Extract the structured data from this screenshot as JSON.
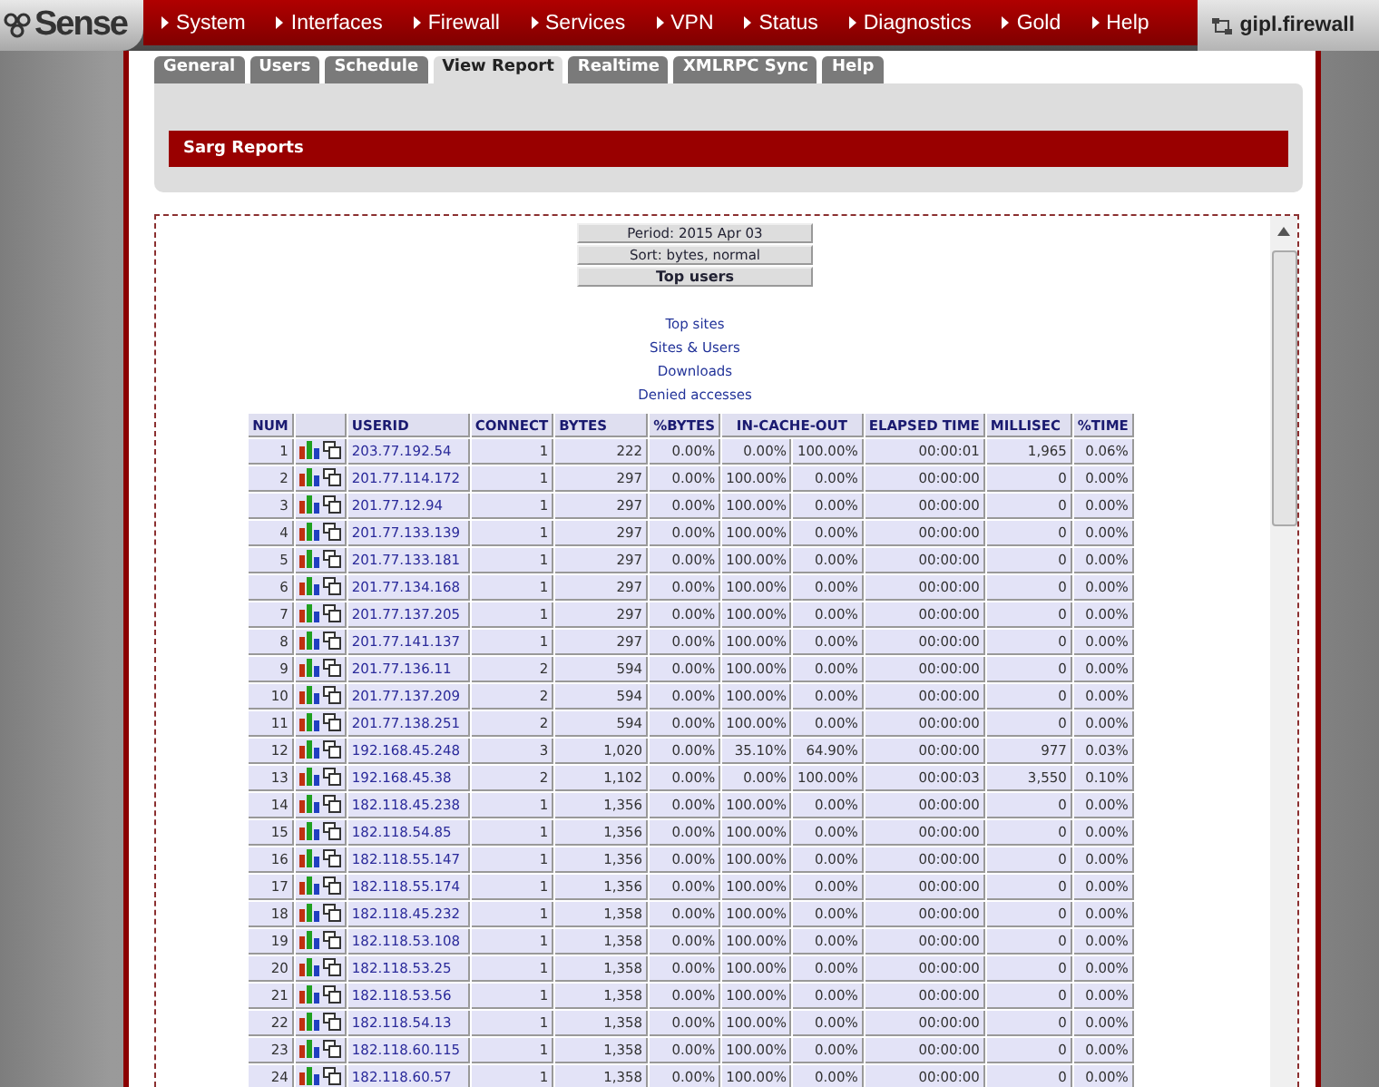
{
  "logo": {
    "text": "Sense"
  },
  "nav": [
    "System",
    "Interfaces",
    "Firewall",
    "Services",
    "VPN",
    "Status",
    "Diagnostics",
    "Gold",
    "Help"
  ],
  "host": "gipl.firewall",
  "tabs": [
    {
      "label": "General",
      "selected": false
    },
    {
      "label": "Users",
      "selected": false
    },
    {
      "label": "Schedule",
      "selected": false
    },
    {
      "label": "View Report",
      "selected": true
    },
    {
      "label": "Realtime",
      "selected": false
    },
    {
      "label": "XMLRPC Sync",
      "selected": false
    },
    {
      "label": "Help",
      "selected": false
    }
  ],
  "section_title": "Sarg Reports",
  "report": {
    "info": [
      "Period: 2015 Apr 03",
      "Sort: bytes, normal",
      "Top users"
    ],
    "links": [
      "Top sites",
      "Sites & Users",
      "Downloads",
      "Denied accesses"
    ],
    "columns": [
      {
        "label": "NUM",
        "kind": "single"
      },
      {
        "label": "USERID",
        "kind": "single"
      },
      {
        "label": "CONNECT",
        "kind": "single"
      },
      {
        "label": "BYTES",
        "kind": "single"
      },
      {
        "label": "%BYTES",
        "kind": "single"
      },
      {
        "label": "IN-CACHE-OUT",
        "kind": "pair"
      },
      {
        "label": "ELAPSED TIME",
        "kind": "single"
      },
      {
        "label": "MILLISEC",
        "kind": "single"
      },
      {
        "label": "%TIME",
        "kind": "single"
      }
    ],
    "rows": [
      {
        "num": "1",
        "userid": "203.77.192.54",
        "values": [
          "1",
          "222",
          "0.00%",
          "0.00%",
          "100.00%",
          "00:00:01",
          "1,965",
          "0.06%"
        ]
      },
      {
        "num": "2",
        "userid": "201.77.114.172",
        "values": [
          "1",
          "297",
          "0.00%",
          "100.00%",
          "0.00%",
          "00:00:00",
          "0",
          "0.00%"
        ]
      },
      {
        "num": "3",
        "userid": "201.77.12.94",
        "values": [
          "1",
          "297",
          "0.00%",
          "100.00%",
          "0.00%",
          "00:00:00",
          "0",
          "0.00%"
        ]
      },
      {
        "num": "4",
        "userid": "201.77.133.139",
        "values": [
          "1",
          "297",
          "0.00%",
          "100.00%",
          "0.00%",
          "00:00:00",
          "0",
          "0.00%"
        ]
      },
      {
        "num": "5",
        "userid": "201.77.133.181",
        "values": [
          "1",
          "297",
          "0.00%",
          "100.00%",
          "0.00%",
          "00:00:00",
          "0",
          "0.00%"
        ]
      },
      {
        "num": "6",
        "userid": "201.77.134.168",
        "values": [
          "1",
          "297",
          "0.00%",
          "100.00%",
          "0.00%",
          "00:00:00",
          "0",
          "0.00%"
        ]
      },
      {
        "num": "7",
        "userid": "201.77.137.205",
        "values": [
          "1",
          "297",
          "0.00%",
          "100.00%",
          "0.00%",
          "00:00:00",
          "0",
          "0.00%"
        ]
      },
      {
        "num": "8",
        "userid": "201.77.141.137",
        "values": [
          "1",
          "297",
          "0.00%",
          "100.00%",
          "0.00%",
          "00:00:00",
          "0",
          "0.00%"
        ]
      },
      {
        "num": "9",
        "userid": "201.77.136.11",
        "values": [
          "2",
          "594",
          "0.00%",
          "100.00%",
          "0.00%",
          "00:00:00",
          "0",
          "0.00%"
        ]
      },
      {
        "num": "10",
        "userid": "201.77.137.209",
        "values": [
          "2",
          "594",
          "0.00%",
          "100.00%",
          "0.00%",
          "00:00:00",
          "0",
          "0.00%"
        ]
      },
      {
        "num": "11",
        "userid": "201.77.138.251",
        "values": [
          "2",
          "594",
          "0.00%",
          "100.00%",
          "0.00%",
          "00:00:00",
          "0",
          "0.00%"
        ]
      },
      {
        "num": "12",
        "userid": "192.168.45.248",
        "values": [
          "3",
          "1,020",
          "0.00%",
          "35.10%",
          "64.90%",
          "00:00:00",
          "977",
          "0.03%"
        ]
      },
      {
        "num": "13",
        "userid": "192.168.45.38",
        "values": [
          "2",
          "1,102",
          "0.00%",
          "0.00%",
          "100.00%",
          "00:00:03",
          "3,550",
          "0.10%"
        ]
      },
      {
        "num": "14",
        "userid": "182.118.45.238",
        "values": [
          "1",
          "1,356",
          "0.00%",
          "100.00%",
          "0.00%",
          "00:00:00",
          "0",
          "0.00%"
        ]
      },
      {
        "num": "15",
        "userid": "182.118.54.85",
        "values": [
          "1",
          "1,356",
          "0.00%",
          "100.00%",
          "0.00%",
          "00:00:00",
          "0",
          "0.00%"
        ]
      },
      {
        "num": "16",
        "userid": "182.118.55.147",
        "values": [
          "1",
          "1,356",
          "0.00%",
          "100.00%",
          "0.00%",
          "00:00:00",
          "0",
          "0.00%"
        ]
      },
      {
        "num": "17",
        "userid": "182.118.55.174",
        "values": [
          "1",
          "1,356",
          "0.00%",
          "100.00%",
          "0.00%",
          "00:00:00",
          "0",
          "0.00%"
        ]
      },
      {
        "num": "18",
        "userid": "182.118.45.232",
        "values": [
          "1",
          "1,358",
          "0.00%",
          "100.00%",
          "0.00%",
          "00:00:00",
          "0",
          "0.00%"
        ]
      },
      {
        "num": "19",
        "userid": "182.118.53.108",
        "values": [
          "1",
          "1,358",
          "0.00%",
          "100.00%",
          "0.00%",
          "00:00:00",
          "0",
          "0.00%"
        ]
      },
      {
        "num": "20",
        "userid": "182.118.53.25",
        "values": [
          "1",
          "1,358",
          "0.00%",
          "100.00%",
          "0.00%",
          "00:00:00",
          "0",
          "0.00%"
        ]
      },
      {
        "num": "21",
        "userid": "182.118.53.56",
        "values": [
          "1",
          "1,358",
          "0.00%",
          "100.00%",
          "0.00%",
          "00:00:00",
          "0",
          "0.00%"
        ]
      },
      {
        "num": "22",
        "userid": "182.118.54.13",
        "values": [
          "1",
          "1,358",
          "0.00%",
          "100.00%",
          "0.00%",
          "00:00:00",
          "0",
          "0.00%"
        ]
      },
      {
        "num": "23",
        "userid": "182.118.60.115",
        "values": [
          "1",
          "1,358",
          "0.00%",
          "100.00%",
          "0.00%",
          "00:00:00",
          "0",
          "0.00%"
        ]
      },
      {
        "num": "24",
        "userid": "182.118.60.57",
        "values": [
          "1",
          "1,358",
          "0.00%",
          "100.00%",
          "0.00%",
          "00:00:00",
          "0",
          "0.00%"
        ]
      }
    ]
  }
}
